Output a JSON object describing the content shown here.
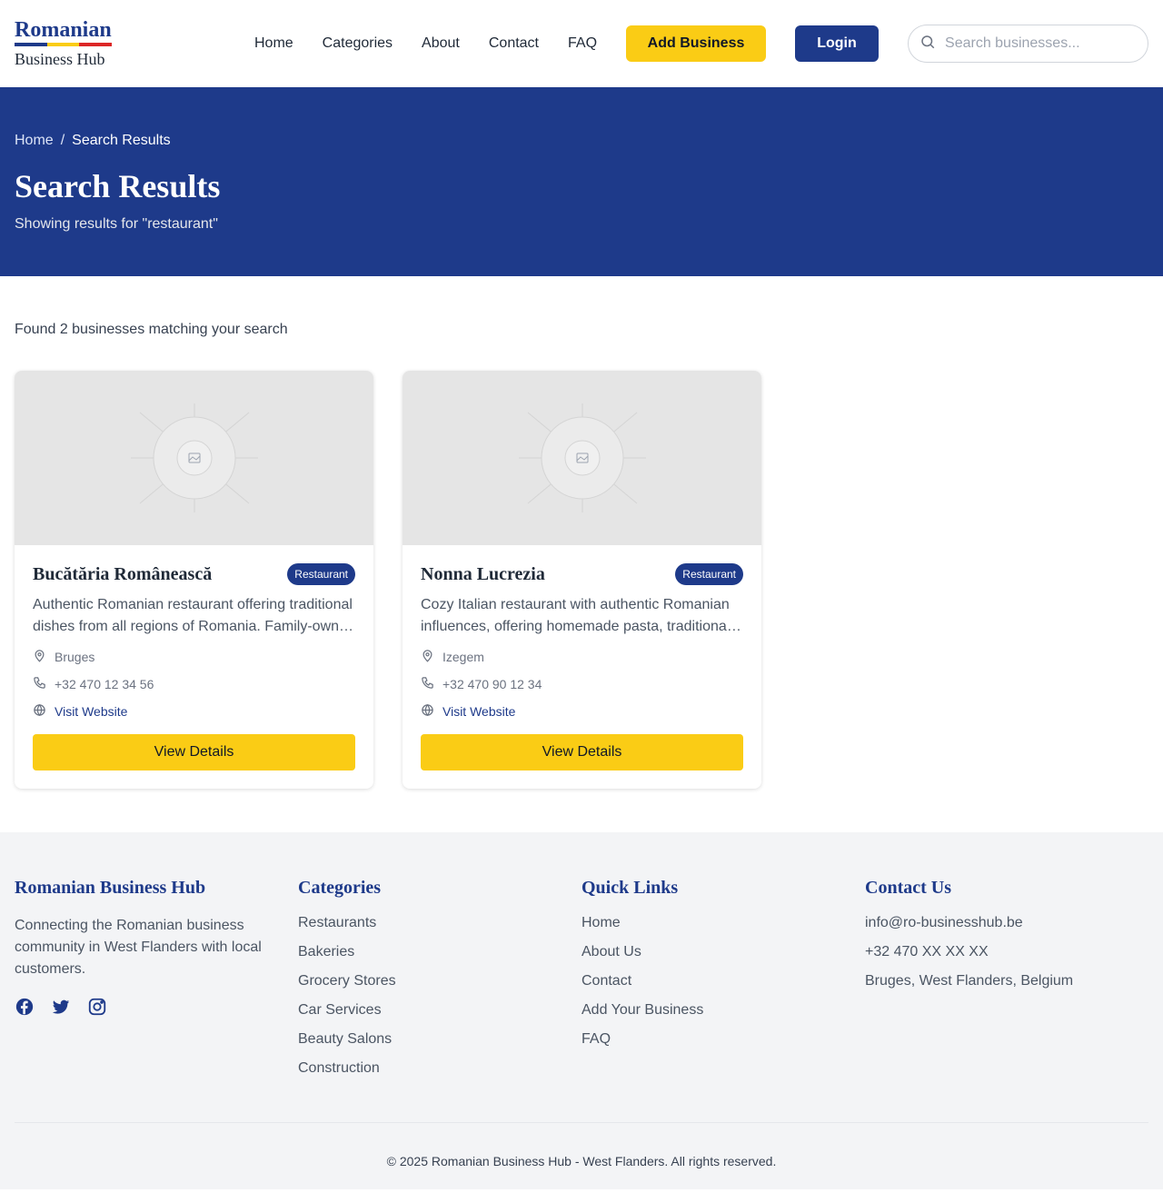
{
  "brand": {
    "top": "Romanian",
    "bottom": "Business Hub",
    "colors": {
      "blue": "#1e3a8a",
      "yellow": "#facc15",
      "red": "#dc2626"
    }
  },
  "nav": {
    "items": [
      "Home",
      "Categories",
      "About",
      "Contact",
      "FAQ"
    ],
    "add_business": "Add Business",
    "login": "Login",
    "search_placeholder": "Search businesses..."
  },
  "hero": {
    "breadcrumb": {
      "home": "Home",
      "separator": "/",
      "current": "Search Results"
    },
    "title": "Search Results",
    "subtitle": "Showing results for \"restaurant\""
  },
  "results": {
    "summary": "Found 2 businesses matching your search",
    "cards": [
      {
        "name": "Bucătăria Românească",
        "category": "Restaurant",
        "description": "Authentic Romanian restaurant offering traditional dishes from all regions of Romania. Family-owned and operated.",
        "city": "Bruges",
        "phone": "+32 470 12 34 56",
        "website_label": "Visit Website",
        "button": "View Details"
      },
      {
        "name": "Nonna Lucrezia",
        "category": "Restaurant",
        "description": "Cozy Italian restaurant with authentic Romanian influences, offering homemade pasta, traditional dishes and more.",
        "city": "Izegem",
        "phone": "+32 470 90 12 34",
        "website_label": "Visit Website",
        "button": "View Details"
      }
    ]
  },
  "footer": {
    "about": {
      "title": "Romanian Business Hub",
      "text": "Connecting the Romanian business community in West Flanders with local customers.",
      "socials": [
        "facebook-icon",
        "twitter-icon",
        "instagram-icon"
      ]
    },
    "categories": {
      "title": "Categories",
      "items": [
        "Restaurants",
        "Bakeries",
        "Grocery Stores",
        "Car Services",
        "Beauty Salons",
        "Construction"
      ]
    },
    "quick_links": {
      "title": "Quick Links",
      "items": [
        "Home",
        "About Us",
        "Contact",
        "Add Your Business",
        "FAQ"
      ]
    },
    "contact": {
      "title": "Contact Us",
      "email": "info@ro-businesshub.be",
      "phone": "+32 470 XX XX XX",
      "address": "Bruges, West Flanders, Belgium"
    },
    "copyright": "© 2025 Romanian Business Hub - West Flanders. All rights reserved."
  }
}
